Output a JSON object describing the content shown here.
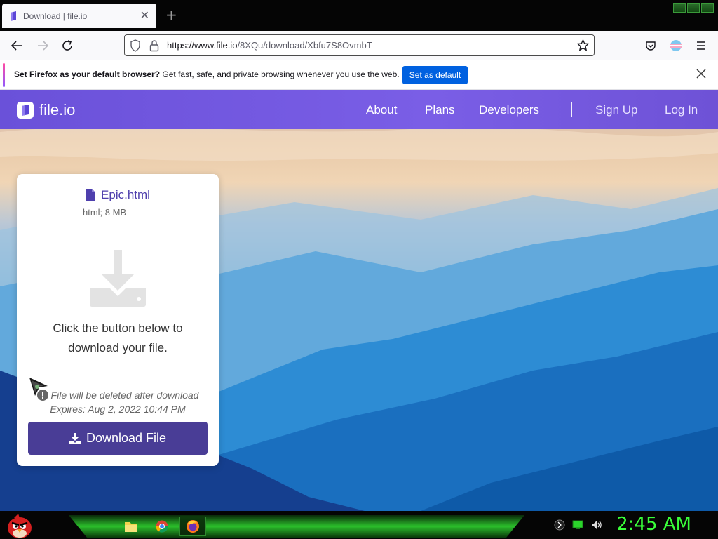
{
  "browser": {
    "tab_title": "Download | file.io",
    "url_domain": "https://www.file.io",
    "url_path": "/8XQu/download/Xbfu7S8OvmbT",
    "notification": {
      "bold_text": "Set Firefox as your default browser?",
      "text": " Get fast, safe, and private browsing whenever you use the web.",
      "button_label": "Set as default"
    }
  },
  "site": {
    "brand": "file.io",
    "nav": [
      "About",
      "Plans",
      "Developers"
    ],
    "sign_up": "Sign Up",
    "log_in": "Log In",
    "accent_color": "#6a51d9"
  },
  "card": {
    "file_name": "Epic.html",
    "file_meta": "html; 8 MB",
    "prompt": "Click the button below to download your file.",
    "warning": "File will be deleted after download",
    "expires": "Expires: Aug 2, 2022 10:44 PM",
    "button_label": "Download File",
    "button_color": "#493d96"
  },
  "taskbar": {
    "clock": "2:45 AM",
    "apps": [
      "folder-icon",
      "chrome-icon",
      "firefox-icon"
    ]
  }
}
